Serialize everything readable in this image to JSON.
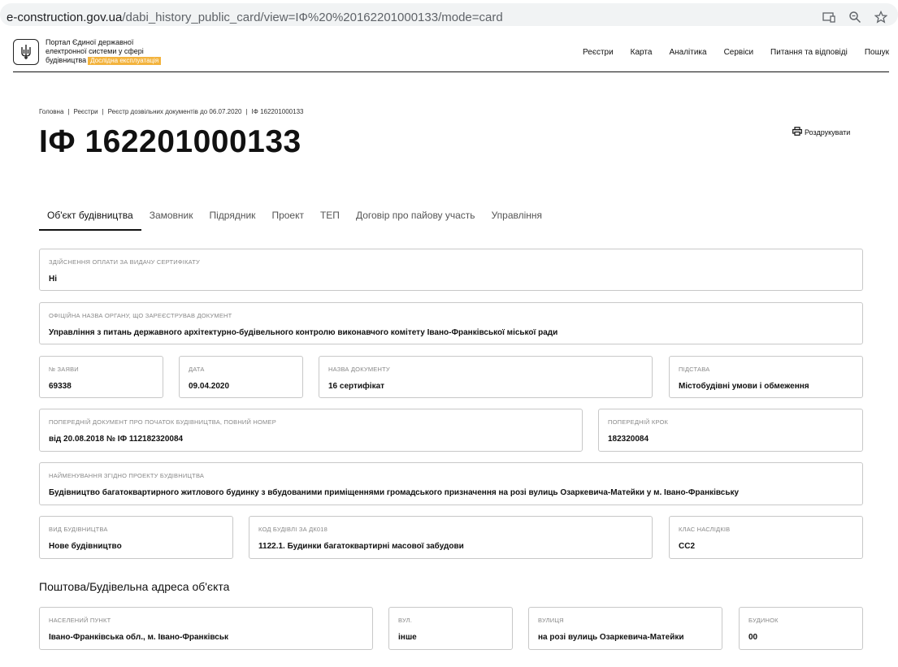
{
  "browser": {
    "url_host": "e-construction.gov.ua",
    "url_path": "/dabi_history_public_card/view=ІФ%20%20162201000133/mode=card"
  },
  "header": {
    "logo_line1": "Портал Єдиної державної",
    "logo_line2": "електронної системи у сфері",
    "logo_line3": "будівництва",
    "beta_badge": "Дослідна експлуатація",
    "nav": [
      "Реєстри",
      "Карта",
      "Аналітика",
      "Сервіси",
      "Питання та відповіді",
      "Пошук"
    ]
  },
  "breadcrumb": [
    "Головна",
    "Реєстри",
    "Реєстр дозвільних документів до 06.07.2020",
    "ІФ 162201000133"
  ],
  "title": "ІФ 162201000133",
  "print_label": "Роздрукувати",
  "tabs": [
    {
      "label": "Об'єкт будівництва",
      "active": true
    },
    {
      "label": "Замовник",
      "active": false
    },
    {
      "label": "Підрядник",
      "active": false
    },
    {
      "label": "Проект",
      "active": false
    },
    {
      "label": "ТЕП",
      "active": false
    },
    {
      "label": "Договір про пайову участь",
      "active": false
    },
    {
      "label": "Управління",
      "active": false
    }
  ],
  "fields": {
    "payment": {
      "label": "Здійснення оплати за видачу сертифікату",
      "value": "Ні"
    },
    "authority": {
      "label": "Офіційна назва органу, що зареєстрував документ",
      "value": "Управління з питань державного архітектурно-будівельного контролю виконавчого комітету Івано-Франківської міської ради"
    },
    "application_no": {
      "label": "№ заяви",
      "value": "69338"
    },
    "date": {
      "label": "Дата",
      "value": "09.04.2020"
    },
    "doc_name": {
      "label": "Назва документу",
      "value": "16 сертифікат"
    },
    "basis": {
      "label": "Підстава",
      "value": "Містобудівні умови і обмеження"
    },
    "prev_doc": {
      "label": "Попередній документ про початок будівництва, повний номер",
      "value": "від 20.08.2018 № ІФ 112182320084"
    },
    "prev_step": {
      "label": "Попередній крок",
      "value": "182320084"
    },
    "project_name": {
      "label": "Найменування згідно проекту будівництва",
      "value": "Будівництво багатоквартирного житлового будинку з вбудованими приміщеннями громадського призначення на розі вулиць Озаркевича-Матейки у м. Івано-Франківську"
    },
    "construction_type": {
      "label": "Вид будівництва",
      "value": "Нове будівництво"
    },
    "building_code": {
      "label": "Код будівлі за ДК018",
      "value": "1122.1. Будинки багатоквартирні масової забудови"
    },
    "consequence_class": {
      "label": "Клас наслідків",
      "value": "СС2"
    }
  },
  "address_section": {
    "title": "Поштова/Будівельна адреса об'єкта",
    "locality": {
      "label": "Населений пункт",
      "value": "Івано-Франківська обл., м. Івано-Франківськ"
    },
    "street_type": {
      "label": "Вул.",
      "value": "інше"
    },
    "street": {
      "label": "Вулиця",
      "value": "на розі вулиць Озаркевича-Матейки"
    },
    "building": {
      "label": "Будинок",
      "value": "00"
    }
  }
}
